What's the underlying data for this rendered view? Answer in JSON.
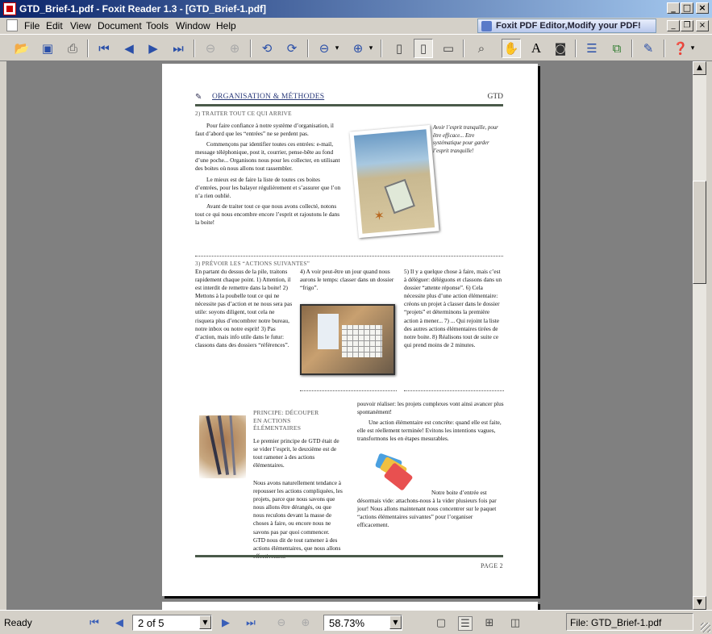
{
  "window": {
    "title": "GTD_Brief-1.pdf - Foxit Reader 1.3 - [GTD_Brief-1.pdf]"
  },
  "menu": [
    "File",
    "Edit",
    "View",
    "Document",
    "Tools",
    "Window",
    "Help"
  ],
  "ad": "Foxit PDF Editor,Modify your PDF!",
  "toolbar_icons": [
    "open-icon",
    "save-icon",
    "print-icon",
    "first-page-icon",
    "prev-page-icon",
    "next-page-icon",
    "last-page-icon",
    "back-icon",
    "forward-icon",
    "rotate-left-icon",
    "rotate-right-icon",
    "zoom-out-icon",
    "zoom-in-icon",
    "actual-size-icon",
    "fit-page-icon",
    "fit-width-icon",
    "find-icon",
    "hand-icon",
    "select-text-icon",
    "snapshot-icon",
    "bookmarks-icon",
    "thumbnails-icon",
    "annotate-icon",
    "help-icon"
  ],
  "doc": {
    "section": "ORGANISATION & MÉTHODES",
    "brand": "GTD",
    "h_traiter": "2) TRAITER TOUT CE QUI ARRIVE",
    "p1": "Pour faire confiance à notre système d’organisation, il faut d’abord que les “entrées” ne se perdent pas.",
    "p2": "Commençons par identifier toutes ces entrées: e-mail, message téléphonique, post it, courrier, pense-bête au fond d’une poche... Organisons nous pour les collecter, en utilisant des boites où nous allons tout rassembler.",
    "p3": "Le mieux est de faire la liste de toutes ces boites d’entrées, pour les balayer régulièrement et s’assurer que l’on n’a rien oublié.",
    "p4": "Avant de traiter tout ce que nous avons collecté, notons tout ce qui nous encombre encore l’esprit et rajoutons le dans la boite!",
    "quote": "Avoir l’esprit tranquille, pour être efficace... Etre systématique pour garder l’esprit tranquille!",
    "h_prevoir": "3) PRÉVOIR LES “ACTIONS SUIVANTES”",
    "col1": "En partant du dessus de la pile, traitons rapidement chaque point. 1) Attention, il est interdit de remettre dans la boite! 2) Mettons à la poubelle tout ce qui ne nécessite pas d’action et ne nous sera pas utile: soyons diligent, tout cela ne risquera plus d’encombrer notre bureau, notre inbox ou notre esprit! 3) Pas d’action, mais info utile dans le futur: classons dans des dossiers “références”.",
    "col2": "4) A voir peut-être un jour quand nous aurons le temps: classer dans un dossier “frigo”.",
    "col3": "5) Il y a quelque chose à faire, mais c’est à déléguer: déléguons et classons dans un dossier “attente réponse”. 6) Cela nécessite plus d’une action élémentaire: créons un projet à classer dans le dossier “projets” et déterminons la première action à mener... 7) ... Qui rejoint la liste des autres actions élémentaires tirées de notre boite. 8) Réalisons tout de suite ce qui prend moins de 2 minutes.",
    "h_principe": "PRINCIPE: DÉCOUPER EN ACTIONS ÉLÉMENTAIRES",
    "p5": "Le premier principe de GTD était de se vider l’esprit, le deuxième est de tout ramener à des actions élémentaires.",
    "p6": "Nous avons naturellement tendance à repousser les actions compliquées, les projets, parce que nous savons que nous allons être dérangés, ou que nous reculons devant la masse de choses à faire, ou encore nous ne savons pas par quoi commencer. GTD nous dit de tout ramener à des actions élémentaires, que nous allons effectivement",
    "p7": "pouvoir réaliser: les projets complexes vont ainsi avancer plus spontanément!",
    "p8": "Une action élémentaire est concrète: quand elle est faite, elle est réellement terminée! Evitons les intentions vagues, transformons les en étapes mesurables.",
    "p9": "Notre boite d’entrée est désormais vide: attachons-nous à la vider plusieurs fois par jour! Nous allons maintenant nous concentrer sur le paquet “actions élémentaires suivantes” pour l’organiser efficacement.",
    "footer": "PAGE 2"
  },
  "status": {
    "ready": "Ready",
    "page": "2 of 5",
    "zoom": "58.73%",
    "file": "File: GTD_Brief-1.pdf"
  }
}
